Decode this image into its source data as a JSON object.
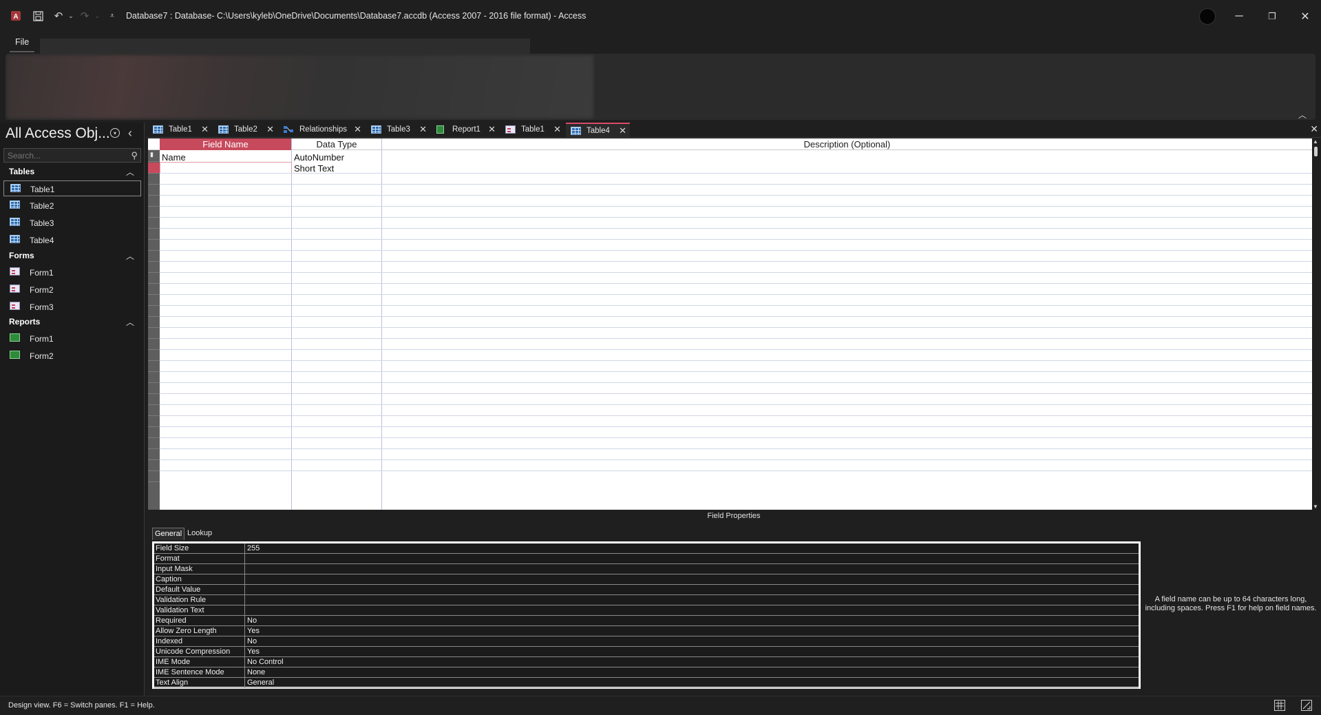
{
  "titlebar": {
    "title": "Database7 : Database- C:\\Users\\kyleb\\OneDrive\\Documents\\Database7.accdb (Access 2007 - 2016 file format)  -  Access",
    "app_icon": "access-logo-icon",
    "minimize": "─",
    "restore": "❐",
    "close": "✕"
  },
  "ribbon": {
    "file_tab": "File"
  },
  "nav": {
    "title": "All Access Obj...",
    "search_placeholder": "Search...",
    "sections": {
      "tables": {
        "label": "Tables",
        "items": [
          "Table1",
          "Table2",
          "Table3",
          "Table4"
        ]
      },
      "forms": {
        "label": "Forms",
        "items": [
          "Form1",
          "Form2",
          "Form3"
        ]
      },
      "reports": {
        "label": "Reports",
        "items": [
          "Form1",
          "Form2"
        ]
      }
    }
  },
  "doc_tabs": [
    {
      "label": "Table1",
      "icon": "table-icon"
    },
    {
      "label": "Table2",
      "icon": "table-icon"
    },
    {
      "label": "Relationships",
      "icon": "relationships-icon"
    },
    {
      "label": "Table3",
      "icon": "table-icon"
    },
    {
      "label": "Report1",
      "icon": "report-icon"
    },
    {
      "label": "Table1",
      "icon": "form-icon"
    },
    {
      "label": "Table4",
      "icon": "table-icon",
      "active": true
    }
  ],
  "design_grid": {
    "headers": {
      "field_name": "Field Name",
      "data_type": "Data Type",
      "description": "Description (Optional)"
    },
    "rows": [
      {
        "field_name": "Name",
        "data_type": "AutoNumber",
        "description": ""
      },
      {
        "field_name": "",
        "data_type": "Short Text",
        "description": ""
      }
    ]
  },
  "field_properties": {
    "label": "Field Properties",
    "tabs": [
      "General",
      "Lookup"
    ],
    "active_tab": "General",
    "rows": [
      {
        "key": "Field Size",
        "value": "255"
      },
      {
        "key": "Format",
        "value": ""
      },
      {
        "key": "Input Mask",
        "value": ""
      },
      {
        "key": "Caption",
        "value": ""
      },
      {
        "key": "Default Value",
        "value": ""
      },
      {
        "key": "Validation Rule",
        "value": ""
      },
      {
        "key": "Validation Text",
        "value": ""
      },
      {
        "key": "Required",
        "value": "No"
      },
      {
        "key": "Allow Zero Length",
        "value": "Yes"
      },
      {
        "key": "Indexed",
        "value": "No"
      },
      {
        "key": "Unicode Compression",
        "value": "Yes"
      },
      {
        "key": "IME Mode",
        "value": "No Control"
      },
      {
        "key": "IME Sentence Mode",
        "value": "None"
      },
      {
        "key": "Text Align",
        "value": "General"
      }
    ],
    "help_text": "A field name can be up to 64 characters long, including spaces. Press F1 for help on field names."
  },
  "statusbar": {
    "text": "Design view.  F6 = Switch panes.  F1 = Help."
  },
  "colors": {
    "accent": "#d94b6a",
    "background": "#1f1f1f",
    "grid": "#ffffff"
  }
}
